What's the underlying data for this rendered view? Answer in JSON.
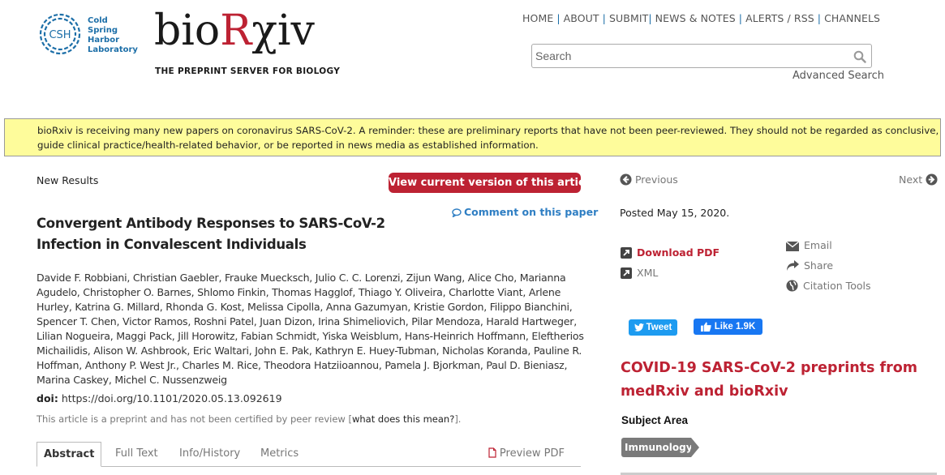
{
  "logos": {
    "csh_initials": "CSH",
    "csh_name_lines": [
      "Cold",
      "Spring",
      "Harbor",
      "Laboratory"
    ],
    "biorxiv_prefix": "bio",
    "biorxiv_r": "R",
    "biorxiv_suffix": "χiv",
    "tagline": "THE PREPRINT SERVER FOR BIOLOGY"
  },
  "top_nav": {
    "items": [
      "HOME",
      "ABOUT",
      "SUBMIT",
      "NEWS & NOTES",
      "ALERTS / RSS",
      "CHANNELS"
    ]
  },
  "search": {
    "placeholder": "Search",
    "value": "",
    "icon": "search-icon",
    "advanced_label": "Advanced Search"
  },
  "banner": {
    "text": "bioRxiv is receiving many new papers on coronavirus SARS-CoV-2.  A reminder: these are preliminary reports that have not been peer-reviewed. They should not be regarded as conclusive, guide clinical practice/health-related behavior, or be reported in news media as established information."
  },
  "article": {
    "type": "New Results",
    "view_current_label": "View current version of this article",
    "comment_label": "Comment on this paper",
    "title": "Convergent Antibody Responses to SARS-CoV-2 Infection in Convalescent Individuals",
    "authors": "Davide F. Robbiani, Christian Gaebler, Frauke Muecksch, Julio C. C. Lorenzi, Zijun Wang, Alice Cho, Marianna Agudelo, Christopher O. Barnes, Shlomo Finkin, Thomas Hagglof, Thiago Y. Oliveira, Charlotte Viant, Arlene Hurley, Katrina G. Millard, Rhonda G. Kost, Melissa Cipolla, Anna Gazumyan, Kristie Gordon, Filippo Bianchini, Spencer T. Chen, Victor Ramos, Roshni Patel, Juan Dizon, Irina Shimeliovich, Pilar Mendoza, Harald Hartweger, Lilian Nogueira, Maggi Pack, Jill Horowitz, Fabian Schmidt, Yiska Weisblum, Hans-Heinrich Hoffmann, Eleftherios Michailidis, Alison W. Ashbrook, Eric Waltari, John E. Pak, Kathryn E. Huey-Tubman, Nicholas Koranda, Pauline R. Hoffman, Anthony P. West Jr., Charles M. Rice, Theodora Hatziioannou, Pamela J. Bjorkman, Paul D. Bieniasz, Marina Caskey, Michel C. Nussenzweig",
    "doi_label": "doi:",
    "doi_value": "https://doi.org/10.1101/2020.05.13.092619",
    "preprint_note": "This article is a preprint and has not been certified by peer review [",
    "preprint_link": "what does this mean?",
    "preprint_note_end": "]."
  },
  "tabs": {
    "items": [
      "Abstract",
      "Full Text",
      "Info/History",
      "Metrics"
    ],
    "active": "Abstract",
    "preview_pdf": "Preview PDF"
  },
  "sidebar": {
    "previous": "Previous",
    "next": "Next",
    "posted": "Posted May 15, 2020.",
    "download_pdf": "Download PDF",
    "xml": "XML",
    "email": "Email",
    "share": "Share",
    "citation_tools": "Citation Tools",
    "tweet": "Tweet",
    "like": "Like 1.9K",
    "covid_heading": "COVID-19 SARS-CoV-2 preprints from medRxiv and bioRxiv",
    "subject_heading": "Subject Area",
    "subject_tag": "Immunology"
  },
  "colors": {
    "brand_red": "#bd2233",
    "link_blue": "#2e7ec3",
    "banner_yellow": "#fefc9b",
    "csh_blue": "#1d6fa8",
    "twitter_blue": "#1d9bf0",
    "facebook_blue": "#1877f2",
    "tag_gray": "#7a7a7a"
  }
}
